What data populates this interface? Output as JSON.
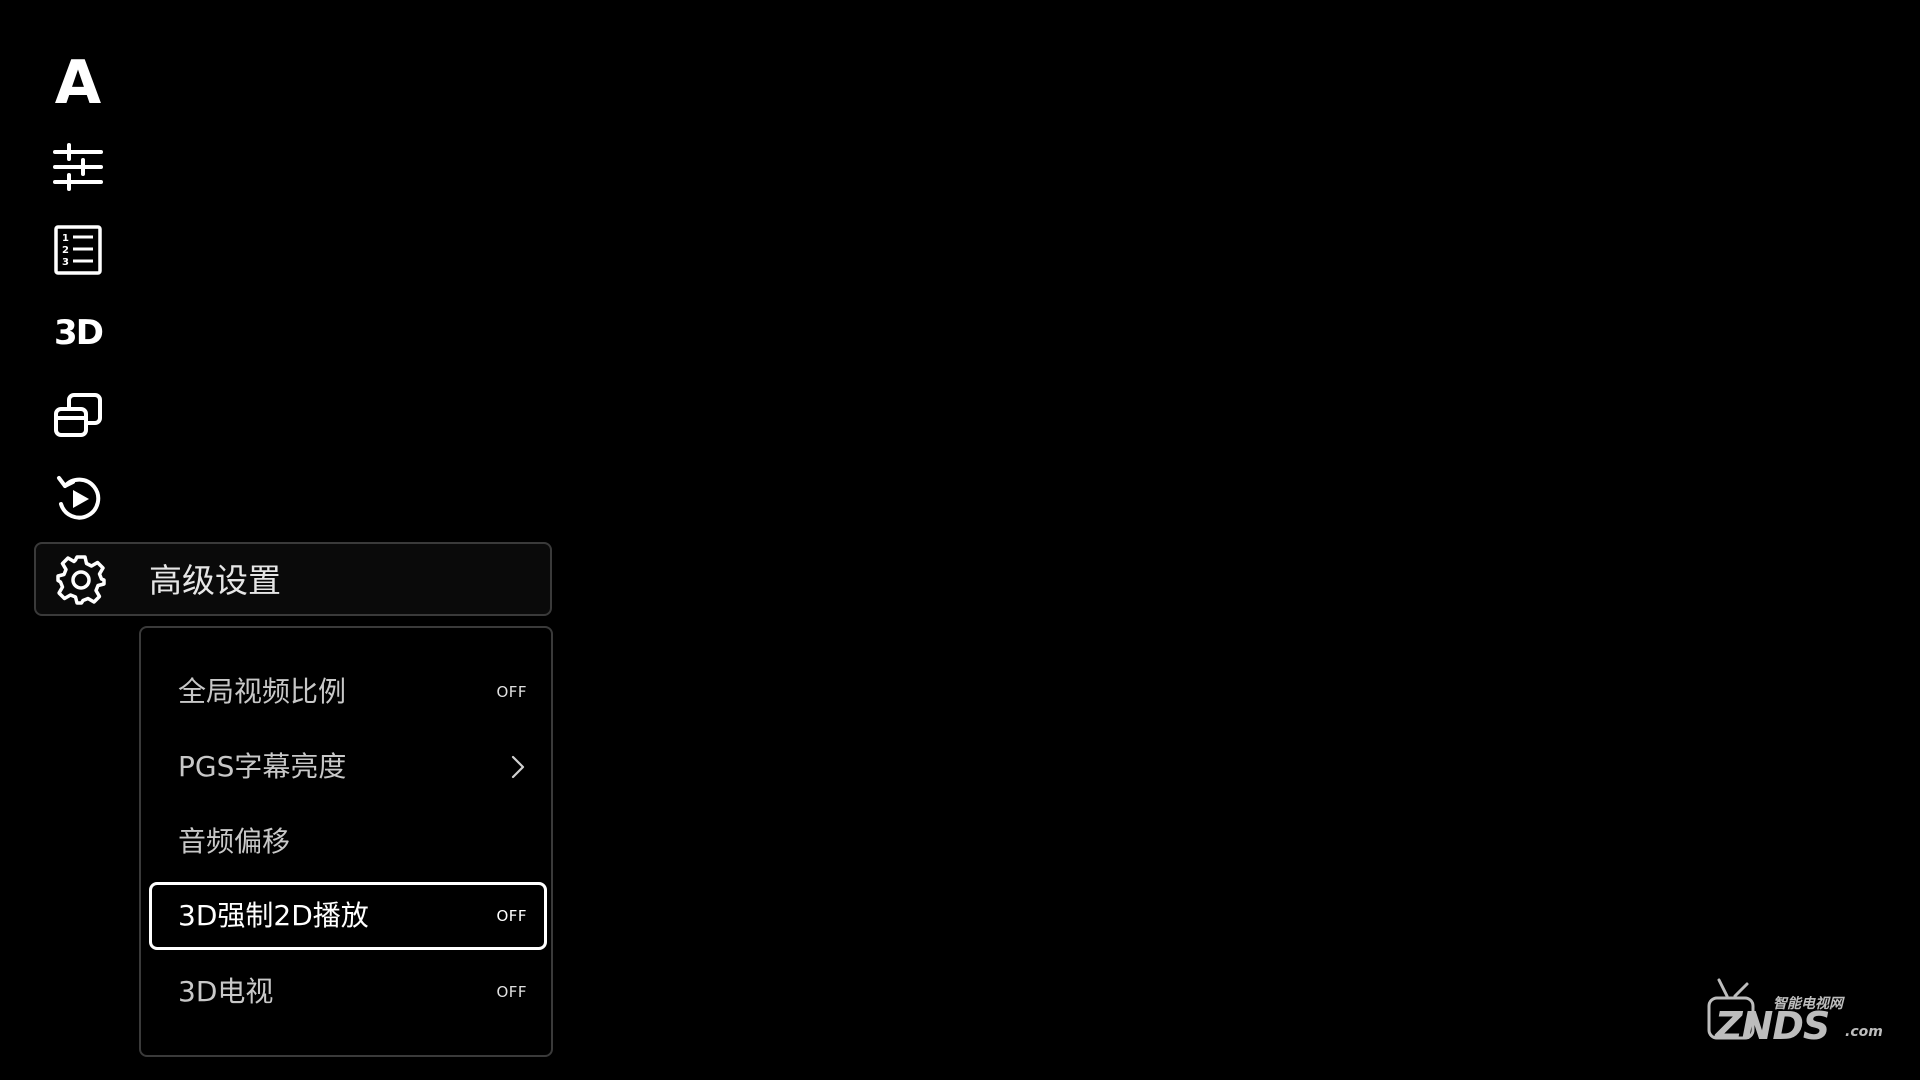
{
  "rail": {
    "icons": [
      {
        "name": "font-icon",
        "glyph": "A"
      },
      {
        "name": "equalizer-sliders-icon"
      },
      {
        "name": "numbered-list-icon"
      },
      {
        "name": "3d-icon",
        "glyph": "3D"
      },
      {
        "name": "window-switch-icon"
      },
      {
        "name": "replay-icon"
      },
      {
        "name": "gear-icon"
      }
    ]
  },
  "advanced": {
    "label": "高级设置"
  },
  "submenu": {
    "items": [
      {
        "label": "全局视频比例",
        "value": "OFF",
        "control": "toggle"
      },
      {
        "label": "PGS字幕亮度",
        "control": "chevron-right-icon"
      },
      {
        "label": "音频偏移",
        "control": "none"
      },
      {
        "label": "3D强制2D播放",
        "value": "OFF",
        "control": "toggle",
        "focused": true
      },
      {
        "label": "3D电视",
        "value": "OFF",
        "control": "toggle"
      }
    ]
  },
  "watermark": {
    "cn": "智能电视网",
    "main": "ZNDS",
    "suffix": ".com"
  },
  "colors": {
    "background": "#000000",
    "foreground": "#ffffff",
    "border": "#3a3a3a"
  }
}
